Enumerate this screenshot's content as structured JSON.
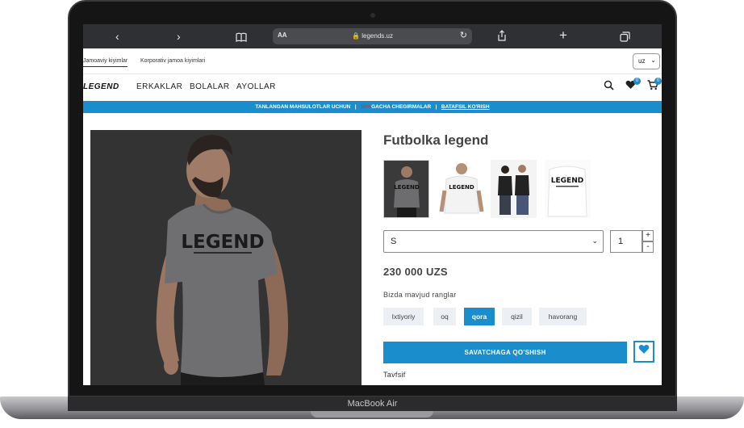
{
  "device": {
    "label": "MacBook Air"
  },
  "browser": {
    "text_size_label": "AA",
    "url": "legends.uz",
    "icons": [
      "chevron-left-icon",
      "chevron-right-icon",
      "book-icon",
      "lock-icon",
      "reload-icon",
      "share-icon",
      "plus-icon",
      "tabs-icon"
    ]
  },
  "topbar": {
    "links": [
      "Jamoaviy kiyimlar",
      "Korporativ jamoa kiyimlari"
    ],
    "language": "uz"
  },
  "nav": {
    "logo": "LEGEND",
    "items": [
      "ERKAKLAR",
      "BOLALAR",
      "AYOLLAR"
    ],
    "wishlist_count": "0",
    "cart_count": "0"
  },
  "promo": {
    "text_before": "TANLANGAN MAHSULOTLAR UCHUN",
    "separator": "|",
    "highlight": "50%",
    "text_after": "GACHA CHEGIRMALAR",
    "link": "BATAFSIL KO'RISH"
  },
  "product": {
    "title": "Futbolka legend",
    "shirt_print": "LEGEND",
    "thumb_print": "LEGEND",
    "size": "S",
    "quantity": "1",
    "qty_plus": "+",
    "qty_minus": "-",
    "price": "230 000 UZS",
    "colors_label": "Bizda mavjud ranglar",
    "colors": [
      "Ixtiyoriy",
      "oq",
      "qora",
      "qizil",
      "havorang"
    ],
    "selected_color": "qora",
    "add_to_cart": "SAVATCHAGA QO'SHISH",
    "description_label": "Tavfsif"
  },
  "colors": {
    "accent": "#1a8dcc",
    "promo_highlight": "#d8342c",
    "photo_bg": "#333334"
  }
}
